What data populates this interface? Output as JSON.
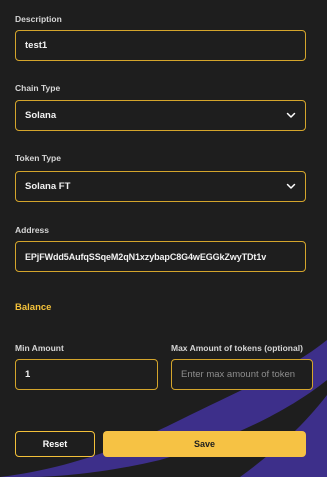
{
  "form": {
    "description": {
      "label": "Description",
      "value": "test1"
    },
    "chain_type": {
      "label": "Chain Type",
      "value": "Solana"
    },
    "token_type": {
      "label": "Token Type",
      "value": "Solana FT"
    },
    "address": {
      "label": "Address",
      "value": "EPjFWdd5AufqSSqeM2qN1xzybapC8G4wEGGkZwyTDt1v"
    },
    "balance": {
      "title": "Balance"
    },
    "min_amount": {
      "label": "Min Amount",
      "value": "1"
    },
    "max_amount": {
      "label": "Max Amount of tokens (optional)",
      "placeholder": "Enter max amount of token"
    }
  },
  "actions": {
    "reset_label": "Reset",
    "save_label": "Save"
  },
  "colors": {
    "accent": "#f6c244",
    "border": "#d4a52c",
    "background": "#1e1e1e",
    "decor": "#3d2f8a"
  }
}
